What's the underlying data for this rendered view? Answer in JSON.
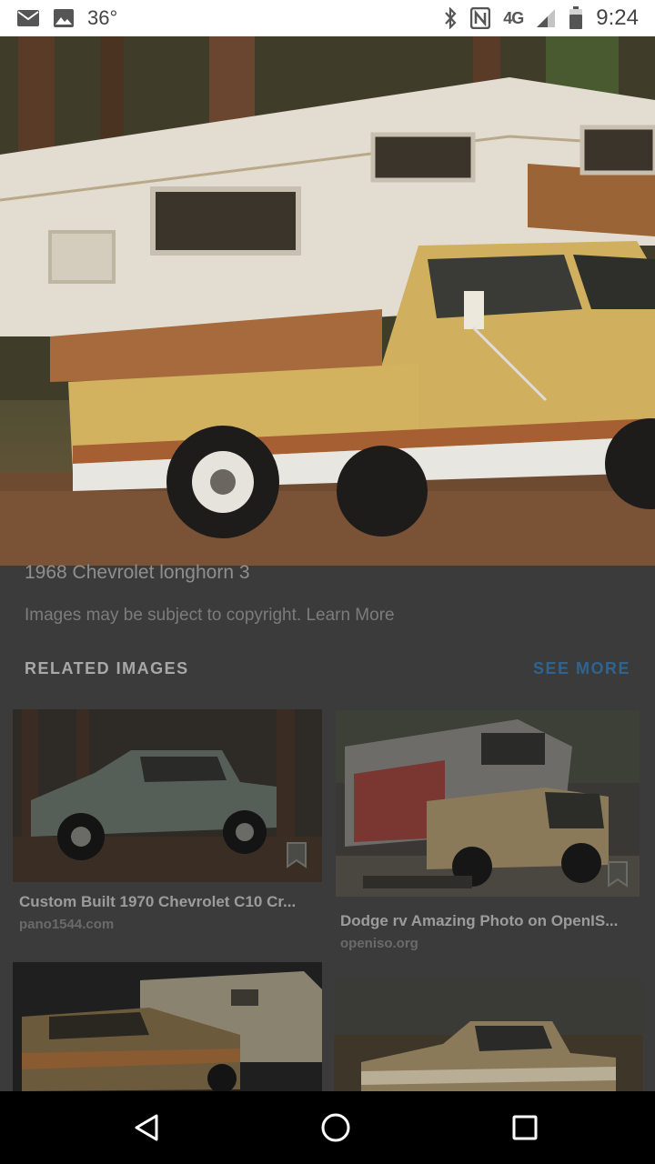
{
  "status_bar": {
    "temperature": "36°",
    "network": "4G",
    "time": "9:24",
    "icons": [
      "mail-icon",
      "image-icon",
      "bluetooth-icon",
      "nfc-icon",
      "signal-icon",
      "battery-icon"
    ]
  },
  "image": {
    "title": "1968 Chevrolet longhorn 3",
    "copyright_text": "Images may be subject to copyright.",
    "learn_more": "Learn More"
  },
  "related": {
    "header": "RELATED IMAGES",
    "see_more": "SEE MORE",
    "items": [
      {
        "caption": "Custom Built 1970 Chevrolet C10 Cr...",
        "domain": "pano1544.com"
      },
      {
        "caption": "Dodge rv Amazing Photo on OpenIS...",
        "domain": "openiso.org"
      },
      {
        "caption": "",
        "domain": ""
      },
      {
        "caption": "",
        "domain": ""
      }
    ]
  },
  "colors": {
    "overlay": "#3b3b3b",
    "accent": "#2f6390"
  },
  "nav": {
    "icons": [
      "back-icon",
      "home-icon",
      "recents-icon"
    ]
  }
}
